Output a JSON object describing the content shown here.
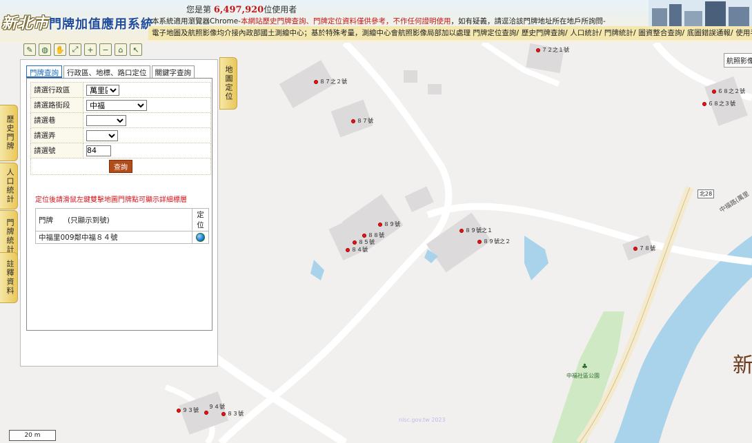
{
  "header": {
    "logo_main": "新北市",
    "logo_sub": "門牌加值應用系統",
    "visitor_prefix": "您是第",
    "visitor_count": "6,497,920",
    "visitor_suffix": "位使用者",
    "notice_1": "本系統適用瀏覽器Chrome-",
    "notice_red": "本網站歷史門牌查詢、門牌定位資料僅供參考，不作任何證明使用",
    "notice_2": "，如有疑義，請逕洽該門牌地址所在地戶所詢問-",
    "nav_text": "電子地圖及航照影像均介接內政部國土測繪中心；基於特殊考量，測繪中心會航照影像局部加以處理",
    "nav_items": [
      "門牌定位查詢",
      "歷史門牌查詢",
      "人口統計",
      "門牌統計",
      "圖資整合查詢",
      "底圖錯誤通報",
      "使用手冊"
    ]
  },
  "toolbar": {
    "icons": [
      "map-edit-icon",
      "zoom-area-icon",
      "pan-icon",
      "full-extent-icon",
      "zoom-in-icon",
      "zoom-out-icon",
      "home-icon",
      "pointer-icon"
    ],
    "glyphs": [
      "✎",
      "◍",
      "✋",
      "⤢",
      "+",
      "−",
      "⌂",
      "↖"
    ]
  },
  "side_tabs": {
    "history": "歷史門牌",
    "population": "人口統計",
    "address_stats": "門牌統計",
    "notes": "註釋資料",
    "locate": "地圖定位"
  },
  "panel": {
    "tabs": [
      "門牌查詢",
      "行政區、地標、路口定位",
      "關鍵字查詢"
    ],
    "fields": {
      "district_label": "請選行政區",
      "district_value": "萬里區",
      "road_label": "請選路街段",
      "road_value": "中福",
      "lane_label": "請選巷",
      "lane_value": "",
      "alley_label": "請選弄",
      "alley_value": "",
      "number_label": "請選號",
      "number_value": "84"
    },
    "submit": "查詢",
    "hint": "定位後請滑鼠左鍵雙擊地圖門牌點可顯示詳細標層",
    "result_header_address": "門牌　　(只顯示到號)",
    "result_header_locate": "定位",
    "results": [
      {
        "address": "中福里009鄰中福８４號"
      }
    ]
  },
  "map": {
    "aerial_button": "航照影像",
    "scale": "20 m",
    "road_label": "中福路(萬里",
    "route": "北28",
    "park": "中福社區公園",
    "big_char": "新",
    "watermark": "nlsc.gov.tw 2023",
    "points": [
      {
        "label": "７２之１號"
      },
      {
        "label": "８７之２號"
      },
      {
        "label": "８７號"
      },
      {
        "label": "６８之２號"
      },
      {
        "label": "６８之３號"
      },
      {
        "label": "８９號"
      },
      {
        "label": "８８號"
      },
      {
        "label": "８５號"
      },
      {
        "label": "８４號"
      },
      {
        "label": "８９號之１"
      },
      {
        "label": "８９號之２"
      },
      {
        "label": "７８號"
      },
      {
        "label": "９４號"
      },
      {
        "label": "９３號"
      },
      {
        "label": "８３號"
      }
    ]
  },
  "colors": {
    "accent_red": "#c41818",
    "tab_gold": "#e9c85a",
    "active_tab_blue": "#1b6bbf",
    "river_blue": "#a9d3ea",
    "park_green": "#cfe9c4"
  }
}
